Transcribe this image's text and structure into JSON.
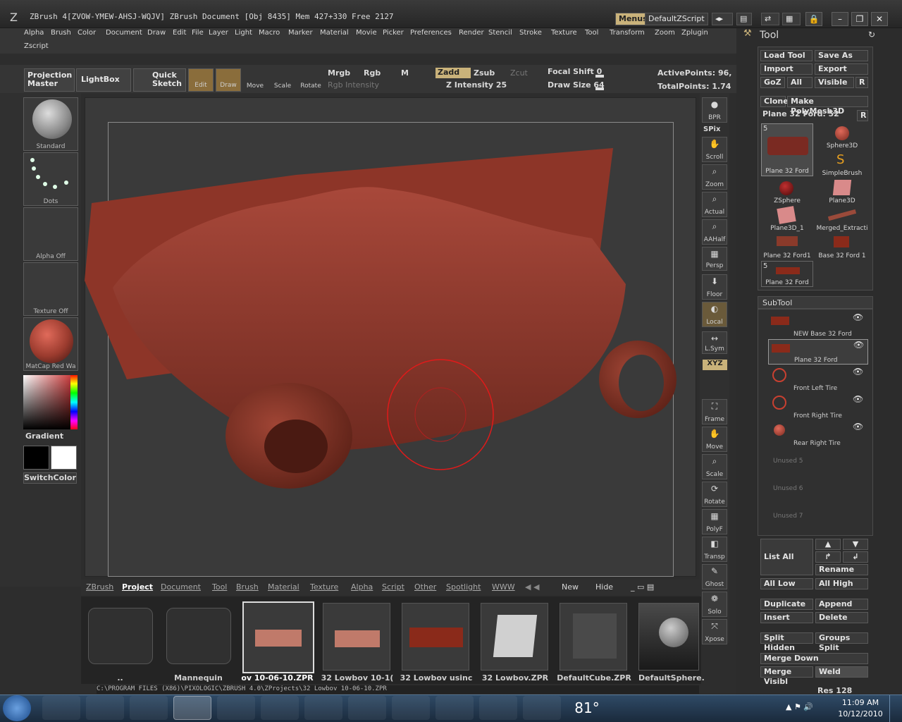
{
  "titlebar": {
    "title": "ZBrush 4[ZVOW-YMEW-AHSJ-WQJV]   ZBrush Document    [Obj 8435] Mem 427+330 Free 2127",
    "menus_btn": "Menus",
    "script_btn": "DefaultZScript"
  },
  "menubar": {
    "items": [
      "Alpha",
      "Brush",
      "Color",
      "Document",
      "Draw",
      "Edit",
      "File",
      "Layer",
      "Light",
      "Macro",
      "Marker",
      "Material",
      "Movie",
      "Picker",
      "Preferences",
      "Render",
      "Stencil",
      "Stroke",
      "Texture",
      "Tool",
      "Transform",
      "Zoom",
      "Zplugin"
    ],
    "row2": "Zscript"
  },
  "toolbar": {
    "projection_master": "Projection Master",
    "lightbox": "LightBox",
    "quick_sketch": "Quick Sketch",
    "edit": "Edit",
    "draw": "Draw",
    "move": "Move",
    "scale": "Scale",
    "rotate": "Rotate",
    "mrgb": "Mrgb",
    "rgb": "Rgb",
    "m": "M",
    "zadd": "Zadd",
    "zsub": "Zsub",
    "zcut": "Zcut",
    "rgb_intensity": "Rgb Intensity",
    "z_intensity": "Z Intensity 25",
    "focal_shift": "Focal Shift 0",
    "draw_size": "Draw Size 64",
    "active_points": "ActivePoints: 96,",
    "total_points": "TotalPoints: 1.74"
  },
  "left_tray": {
    "brush": "Standard",
    "stroke": "Dots",
    "alpha": "Alpha  Off",
    "texture": "Texture  Off",
    "material": "MatCap Red Wa",
    "gradient": "Gradient",
    "switch_color": "SwitchColor"
  },
  "right_shelf": {
    "buttons": [
      "BPR",
      "SPix",
      "Scroll",
      "Zoom",
      "Actual",
      "AAHalf",
      "Persp",
      "Floor",
      "Local",
      "L.Sym",
      "XYZ",
      "Frame",
      "Move",
      "Scale",
      "Rotate",
      "PolyF",
      "Transp",
      "Ghost",
      "Solo",
      "Xpose"
    ]
  },
  "tool_panel": {
    "title": "Tool",
    "load_tool": "Load Tool",
    "save_as": "Save As",
    "import": "Import",
    "export": "Export",
    "goz": "GoZ",
    "all": "All",
    "visible": "Visible",
    "r": "R",
    "clone": "Clone",
    "make_polymesh": "Make PolyMesh3D",
    "current_tool": "Plane 32 Ford. 52",
    "tools": [
      {
        "label": "Plane 32 Ford",
        "count": "5"
      },
      {
        "label": "Sphere3D"
      },
      {
        "label": "SimpleBrush"
      },
      {
        "label": "ZSphere"
      },
      {
        "label": "Plane3D"
      },
      {
        "label": "Plane3D_1"
      },
      {
        "label": "Merged_Extracti"
      },
      {
        "label": "Plane 32 Ford1"
      },
      {
        "label": "Base 32 Ford 1"
      },
      {
        "label": "Plane 32 Ford",
        "count": "5"
      }
    ],
    "subtool_title": "SubTool",
    "subtools": [
      "NEW Base 32 Ford",
      "Plane 32 Ford",
      "Front Left Tire",
      "Front Right Tire",
      "Rear Right Tire",
      "Unused 5",
      "Unused 6",
      "Unused 7"
    ],
    "list_all": "List All",
    "rename": "Rename",
    "all_low": "All Low",
    "all_high": "All High",
    "duplicate": "Duplicate",
    "append": "Append",
    "insert": "Insert",
    "delete": "Delete",
    "split_hidden": "Split Hidden",
    "groups_split": "Groups Split",
    "merge_down": "Merge Down",
    "merge_visible": "Merge Visibl",
    "weld": "Weld",
    "res": "Res 128"
  },
  "bottom": {
    "tabs": [
      "ZBrush",
      "Project",
      "Document",
      "Tool",
      "Brush",
      "Material",
      "Texture",
      "Alpha",
      "Script",
      "Other",
      "Spotlight",
      "WWW"
    ],
    "new": "New",
    "hide": "Hide",
    "projects": [
      "..",
      "Mannequin",
      "ov 10-06-10.ZPR",
      "32 Lowbov 10-1(",
      "32 Lowbov usinc",
      "32 Lowbov.ZPR",
      "DefaultCube.ZPR",
      "DefaultSphere."
    ],
    "path": "C:\\PROGRAM FILES (X86)\\PIXOLOGIC\\ZBRUSH 4.0\\ZProjects\\32 Lowbov 10-06-10.ZPR"
  },
  "taskbar": {
    "temperature": "81°",
    "time": "11:09 AM",
    "date": "10/12/2010"
  },
  "colors": {
    "model": "#9b3b2e",
    "accent_gold": "#c9b27a"
  }
}
